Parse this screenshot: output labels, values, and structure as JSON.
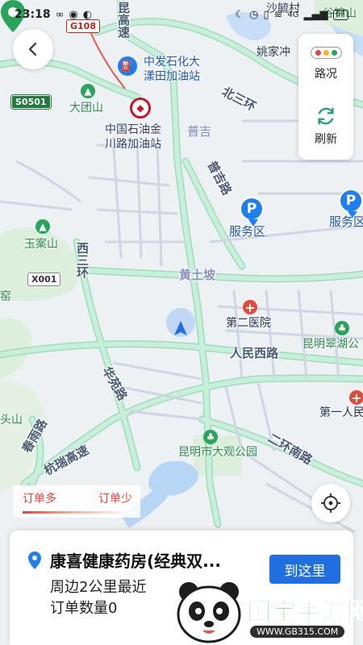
{
  "status_bar": {
    "time": "23:18",
    "signal": "4G",
    "battery": "67"
  },
  "map": {
    "highway_shields": [
      {
        "id": "g108",
        "text": "G108"
      },
      {
        "id": "s0501",
        "text": "S0501"
      },
      {
        "id": "x001",
        "text": "X001"
      }
    ],
    "roads": {
      "kunming_expressway": "昆高速",
      "beisanhuan": "北三环",
      "puji_road": "普吉路",
      "xisanhuan": "西三环",
      "huangtupo": "黄土坡",
      "renmin_west": "人民西路",
      "huayuan_road": "华苑路",
      "kunrui_expressway": "杭瑞高速",
      "chunyu_road": "春雨路",
      "erhuan_south": "二环南路"
    },
    "places": {
      "puji": "普吉",
      "datuanshan": "大团山",
      "yuanshan": "玉案山",
      "yaojiachong": "姚家冲",
      "shahe": "沙毓村",
      "guanyinshan": "谷锦山",
      "tuoshan": "头山",
      "qishan": "窑"
    },
    "pois": {
      "zhongfa_gas": [
        "中发石化大",
        "漾田加油站"
      ],
      "cnpc_gas": [
        "中国石油金",
        "川路加油站"
      ],
      "service_area_1": "服务区",
      "service_area_2": "服务区",
      "second_hospital": "第二医院",
      "kunming_cuihu": "昆明翠湖公",
      "daguan_park": "昆明市大观公园",
      "first_people": "第一人民"
    }
  },
  "right_panel": {
    "traffic_label": "路况",
    "refresh_label": "刷新"
  },
  "legend": {
    "more": "订单多",
    "less": "订单少"
  },
  "store": {
    "name": "康喜健康药房(经典双...",
    "line1": "周边2公里最近",
    "line2": "订单数量0",
    "go_button": "到这里"
  },
  "watermark": {
    "brand": "国宝手游网",
    "url": "WWW.GB315.COM"
  },
  "colors": {
    "accent": "#1f6fe0",
    "road": "#c7efd9",
    "road_edge": "#9fdcbb",
    "water": "#b7d6f6",
    "park": "#d9efd9"
  }
}
